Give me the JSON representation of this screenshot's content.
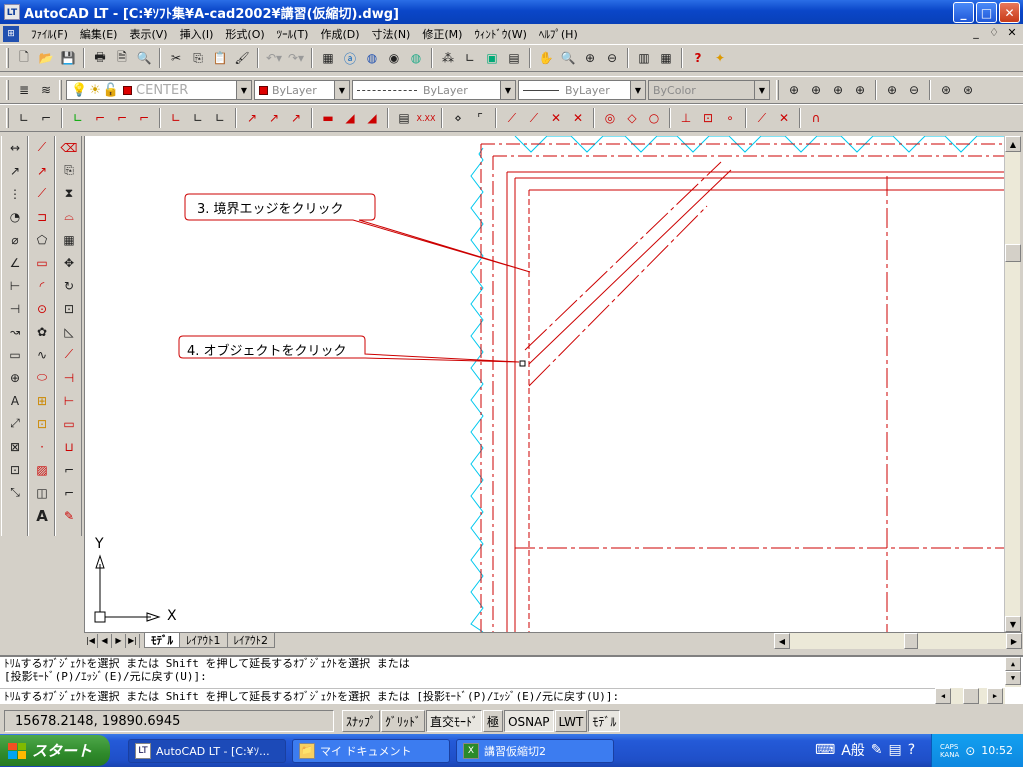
{
  "window": {
    "title": "AutoCAD LT - [C:¥ｿﾌﾄ集¥A-cad2002¥講習(仮縮切).dwg]",
    "app_icon": "LT",
    "buttons": [
      "_",
      "□",
      "✕"
    ]
  },
  "menubar": {
    "items": [
      "ﾌｧｲﾙ(F)",
      "編集(E)",
      "表示(V)",
      "挿入(I)",
      "形式(O)",
      "ﾂｰﾙ(T)",
      "作成(D)",
      "寸法(N)",
      "修正(M)",
      "ｳｨﾝﾄﾞｳ(W)",
      "ﾍﾙﾌﾟ(H)"
    ],
    "mdi_buttons": [
      "_",
      "♢",
      "✕"
    ]
  },
  "layers_toolbar": {
    "layer_name": "CENTER",
    "color": "ByLayer",
    "linetype": "ByLayer",
    "lineweight": "ByLayer",
    "plotstyle": "ByColor"
  },
  "annotations": [
    {
      "text": "3. 境界エッジをクリック"
    },
    {
      "text": "4. オブジェクトをクリック"
    }
  ],
  "ucs": {
    "x_label": "X",
    "y_label": "Y"
  },
  "tabs": [
    "ﾓﾃﾞﾙ",
    "ﾚｲｱｳﾄ1",
    "ﾚｲｱｳﾄ2"
  ],
  "command": {
    "line1": "ﾄﾘﾑするｵﾌﾞｼﾞｪｸﾄを選択 または Shift を押して延長するｵﾌﾞｼﾞｪｸﾄを選択 または",
    "line2": "[投影ﾓｰﾄﾞ(P)/ｴｯｼﾞ(E)/元に戻す(U)]:",
    "line3": "ﾄﾘﾑするｵﾌﾞｼﾞｪｸﾄを選択 または Shift を押して延長するｵﾌﾞｼﾞｪｸﾄを選択 または [投影ﾓｰﾄﾞ(P)/ｴｯｼﾞ(E)/元に戻す(U)]:"
  },
  "status": {
    "coords": "15678.2148, 19890.6945",
    "buttons": [
      {
        "label": "ｽﾅｯﾌﾟ",
        "on": false
      },
      {
        "label": "ｸﾞﾘｯﾄﾞ",
        "on": false
      },
      {
        "label": "直交ﾓｰﾄﾞ",
        "on": true
      },
      {
        "label": "極",
        "on": false
      },
      {
        "label": "OSNAP",
        "on": true
      },
      {
        "label": "LWT",
        "on": false
      },
      {
        "label": "ﾓﾃﾞﾙ",
        "on": true
      }
    ]
  },
  "taskbar": {
    "start": "スタート",
    "tasks": [
      {
        "label": "AutoCAD LT - [C:¥ｿ...",
        "icon": "LT",
        "active": true
      },
      {
        "label": "マイ ドキュメント",
        "icon": "📁",
        "active": false
      },
      {
        "label": "講習仮縮切2",
        "icon": "X",
        "active": false
      }
    ],
    "ime": "A般",
    "caps": "CAPS",
    "kana": "KANA",
    "clock": "10:52"
  },
  "colors": {
    "accent": "#0a46c8",
    "drawing_red": "#cc0000",
    "cyan": "#00ccee"
  }
}
